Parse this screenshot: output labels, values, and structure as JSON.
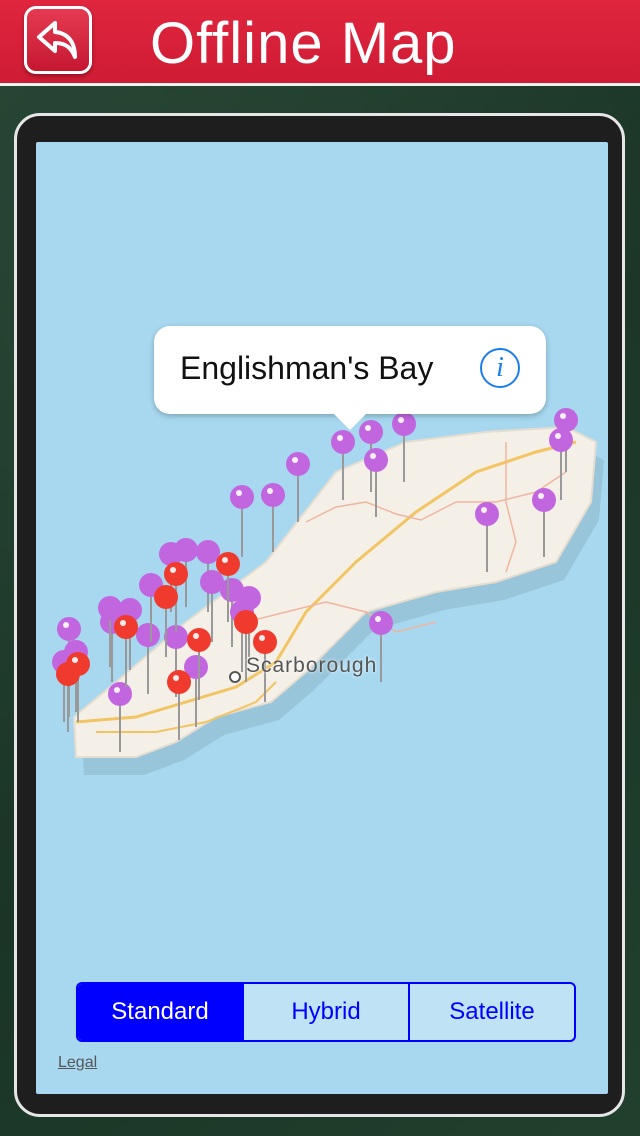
{
  "header": {
    "title": "Offline Map",
    "back_icon": "back-arrow-icon",
    "color": "#d82039"
  },
  "map": {
    "callout": {
      "title": "Englishman's Bay",
      "info_icon": "info-icon",
      "info_glyph": "i"
    },
    "place_label": "Scarborough",
    "pin_colors": {
      "purple": "#c266e0",
      "red": "#f03a2e"
    }
  },
  "segmented_control": {
    "options": [
      "Standard",
      "Hybrid",
      "Satellite"
    ],
    "selected": "Standard"
  },
  "legal_label": "Legal"
}
